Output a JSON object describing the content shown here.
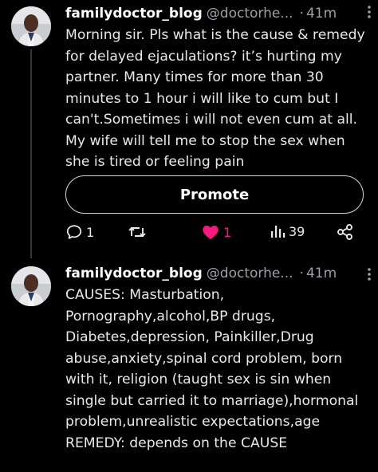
{
  "colors": {
    "background": "#000000",
    "text": "#e7e9ea",
    "muted": "#9aa0a6",
    "like": "#f91880",
    "thread_line": "#333639"
  },
  "posts": [
    {
      "username": "familydoctor_blog",
      "handle": "@doctorhe...",
      "separator": "·",
      "time": "41m",
      "more_icon": "more-vertical-icon",
      "text": "Morning sir. Pls what is the cause & remedy for delayed ejaculations? it’s hurting my partner. Many times for more than 30 minutes to 1 hour i will like to cum but I can't.Sometimes i will not even cum at all. My wife will tell me to stop the sex when she is tired or feeling pain",
      "promote_label": "Promote",
      "actions": {
        "reply_count": "1",
        "repost_count": "",
        "like_count": "1",
        "views_count": "39"
      }
    },
    {
      "username": "familydoctor_blog",
      "handle": "@doctorhe...",
      "separator": "·",
      "time": "41m",
      "more_icon": "more-vertical-icon",
      "text": "CAUSES: Masturbation, Pornography,alcohol,BP drugs, Diabetes,depression, Painkiller,Drug abuse,anxiety,spinal cord problem, born with it, religion (taught sex is sin when single but carried it to marriage),hormonal problem,unrealistic expectations,age\nREMEDY: depends on the CAUSE"
    }
  ]
}
